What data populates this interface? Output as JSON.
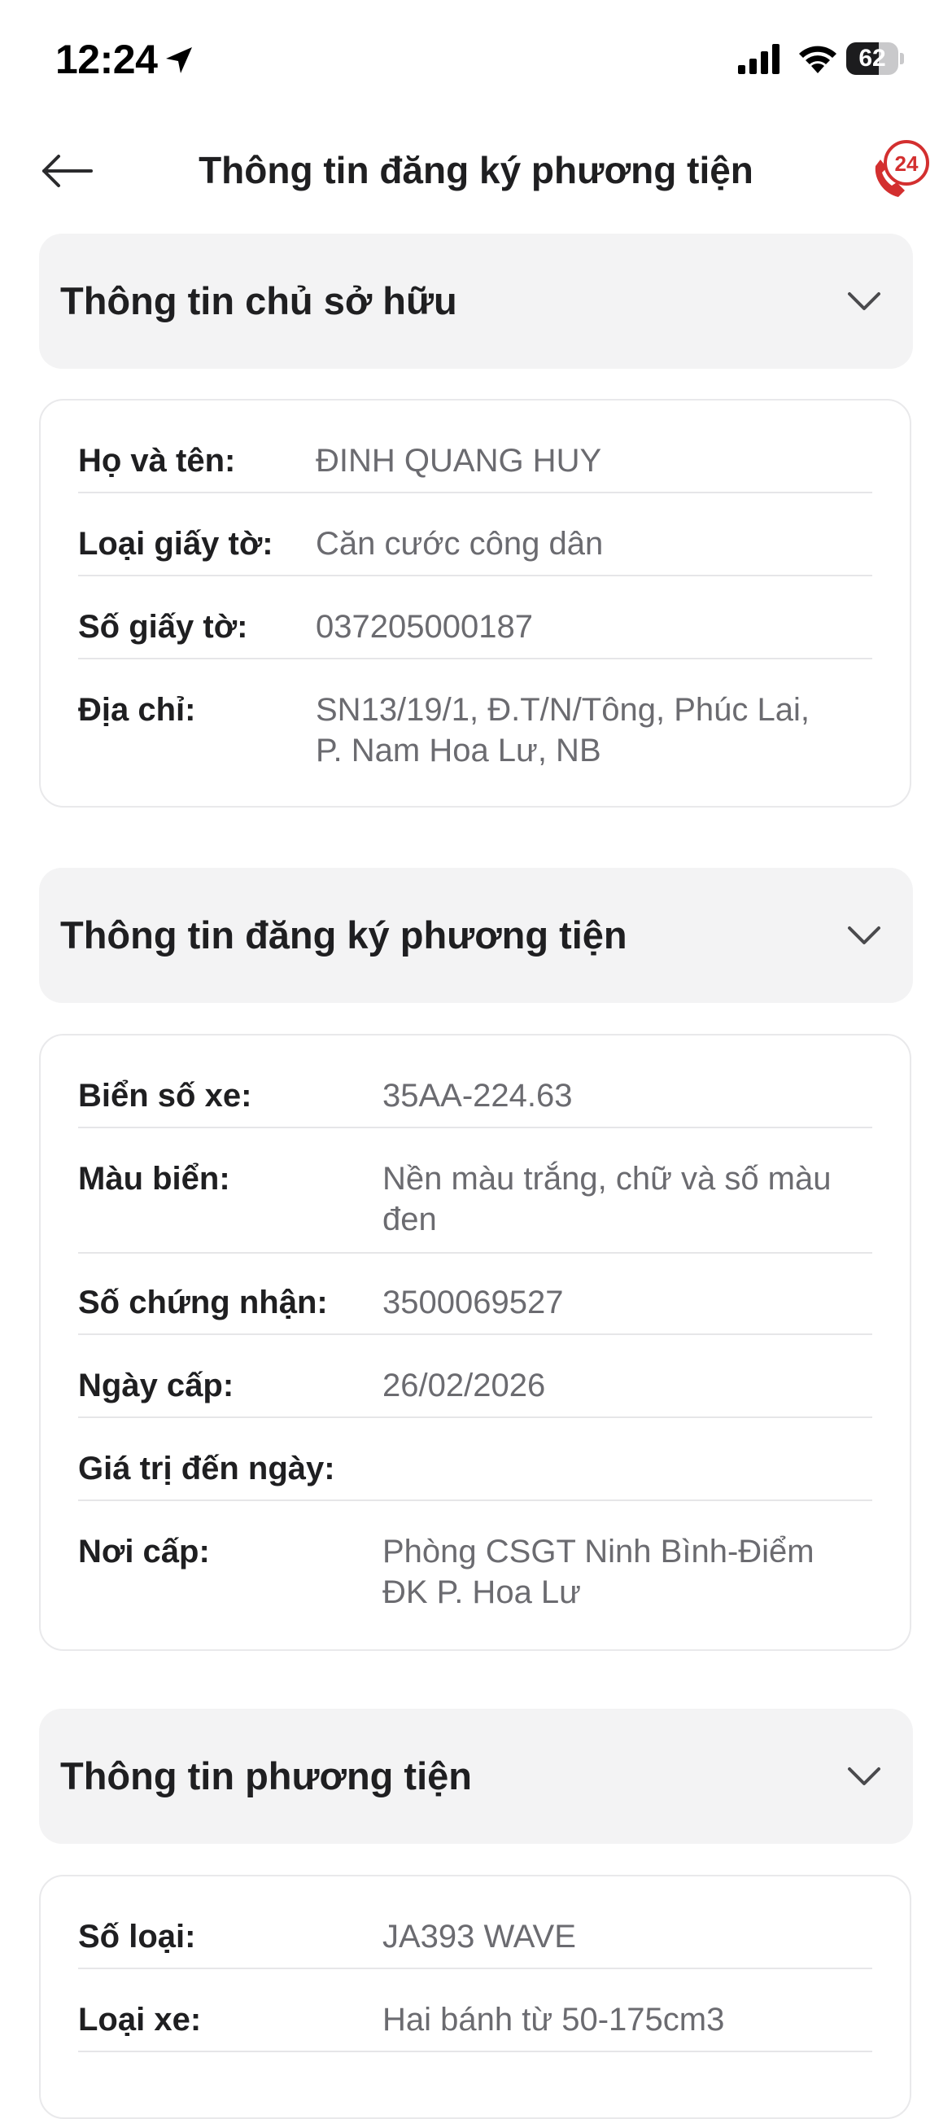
{
  "status_bar": {
    "time": "12:24",
    "battery_level": "62",
    "battery_fraction": 0.62,
    "icons": [
      "location-arrow-icon",
      "cellular-signal-icon",
      "wifi-icon",
      "battery-icon"
    ]
  },
  "header": {
    "title": "Thông tin đăng ký phương tiện",
    "back_icon": "arrow-left-icon",
    "support_badge": "24",
    "support_icon": "phone-24-icon",
    "accent_color": "#d32f2f"
  },
  "sections": {
    "owner": {
      "title": "Thông tin chủ sở hữu",
      "rows": [
        {
          "label": "Họ và tên:",
          "value": "ĐINH QUANG HUY"
        },
        {
          "label": "Loại giấy tờ:",
          "value": "Căn cước công dân"
        },
        {
          "label": "Số giấy tờ:",
          "value": "037205000187"
        },
        {
          "label": "Địa chỉ:",
          "value": "SN13/19/1, Đ.T/N/Tông, Phúc Lai,",
          "value2": "P. Nam Hoa Lư, NB"
        }
      ]
    },
    "registration": {
      "title": "Thông tin đăng ký phương tiện",
      "rows": [
        {
          "label": "Biển số xe:",
          "value": "35AA-224.63"
        },
        {
          "label": "Màu biển:",
          "value": "Nền màu trắng, chữ và số màu",
          "value2": "đen"
        },
        {
          "label": "Số chứng nhận:",
          "value": "3500069527"
        },
        {
          "label": "Ngày cấp:",
          "value": "26/02/2026"
        },
        {
          "label": "Giá trị đến ngày:",
          "value": ""
        },
        {
          "label": "Nơi cấp:",
          "value": "Phòng CSGT Ninh Bình-Điểm",
          "value2": "ĐK P. Hoa Lư"
        }
      ]
    },
    "vehicle": {
      "title": "Thông tin phương tiện",
      "rows": [
        {
          "label": "Số loại:",
          "value": "JA393 WAVE"
        },
        {
          "label": "Loại xe:",
          "value": "Hai bánh từ 50-175cm3"
        }
      ]
    }
  }
}
